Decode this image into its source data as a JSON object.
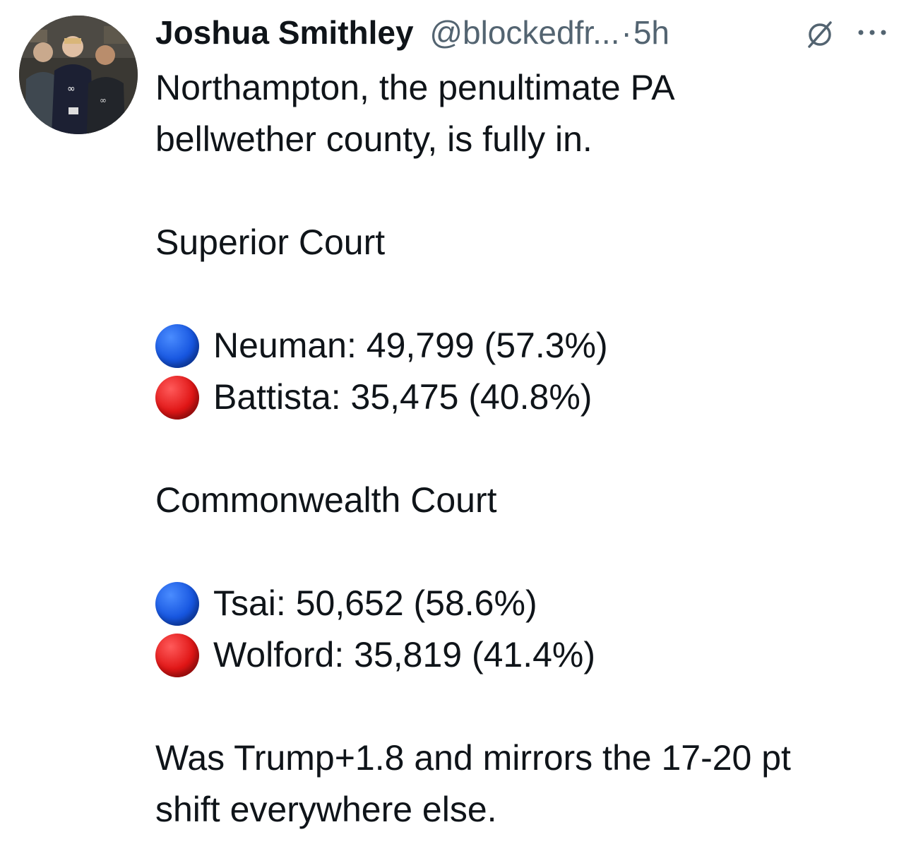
{
  "tweet": {
    "author": {
      "name": "Joshua Smithley",
      "handle": "@blockedfr...",
      "separator": "·",
      "time": "5h"
    },
    "icons": {
      "avatar": "profile-photo",
      "grok": "grok-icon",
      "more": "more-options-icon"
    },
    "body": {
      "intro_line1": "Northampton, the penultimate PA",
      "intro_line2": "bellwether county, is fully in.",
      "section1": {
        "title": "Superior Court",
        "results": [
          {
            "party_color": "#1756e0",
            "text": "Neuman: 49,799 (57.3%)"
          },
          {
            "party_color": "#e01616",
            "text": "Battista: 35,475 (40.8%)"
          }
        ]
      },
      "section2": {
        "title": "Commonwealth Court",
        "results": [
          {
            "party_color": "#1756e0",
            "text": "Tsai: 50,652 (58.6%)"
          },
          {
            "party_color": "#e01616",
            "text": "Wolford: 35,819 (41.4%)"
          }
        ]
      },
      "closing_line1": "Was Trump+1.8 and mirrors the 17-20 pt",
      "closing_line2": "shift everywhere else."
    }
  }
}
